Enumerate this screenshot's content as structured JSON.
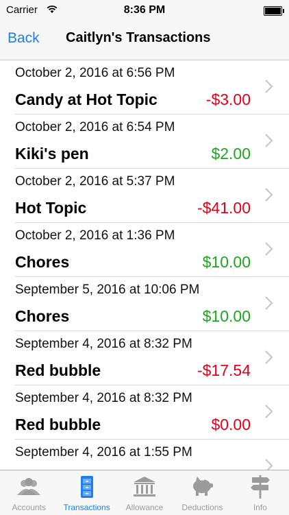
{
  "status_bar": {
    "carrier": "Carrier",
    "time": "8:36 PM"
  },
  "nav": {
    "back_label": "Back",
    "title": "Caitlyn's Transactions"
  },
  "transactions": [
    {
      "date": "October 2, 2016 at 6:56 PM",
      "description": "Candy at Hot Topic",
      "amount": "-$3.00",
      "sign": "negative"
    },
    {
      "date": "October 2, 2016 at 6:54 PM",
      "description": "Kiki's pen",
      "amount": "$2.00",
      "sign": "positive"
    },
    {
      "date": "October 2, 2016 at 5:37 PM",
      "description": "Hot Topic",
      "amount": "-$41.00",
      "sign": "negative"
    },
    {
      "date": "October 2, 2016 at 1:36 PM",
      "description": "Chores",
      "amount": "$10.00",
      "sign": "positive"
    },
    {
      "date": "September 5, 2016 at 10:06 PM",
      "description": "Chores",
      "amount": "$10.00",
      "sign": "positive"
    },
    {
      "date": "September 4, 2016 at 8:32 PM",
      "description": "Red bubble",
      "amount": "-$17.54",
      "sign": "negative"
    },
    {
      "date": "September 4, 2016 at 8:32 PM",
      "description": "Red bubble",
      "amount": "$0.00",
      "sign": "negative"
    },
    {
      "date": "September 4, 2016 at 1:55 PM",
      "description": "",
      "amount": "",
      "sign": ""
    }
  ],
  "tabs": [
    {
      "label": "Accounts",
      "icon": "people-icon"
    },
    {
      "label": "Transactions",
      "icon": "file-cabinet-icon",
      "active": true
    },
    {
      "label": "Allowance",
      "icon": "bank-icon"
    },
    {
      "label": "Deductions",
      "icon": "piggy-bank-icon"
    },
    {
      "label": "Info",
      "icon": "signpost-icon"
    }
  ],
  "colors": {
    "accent": "#1e7ef0",
    "negative": "#e3001b",
    "positive": "#1fa51f",
    "inactive_tab": "#9a9a9a"
  }
}
